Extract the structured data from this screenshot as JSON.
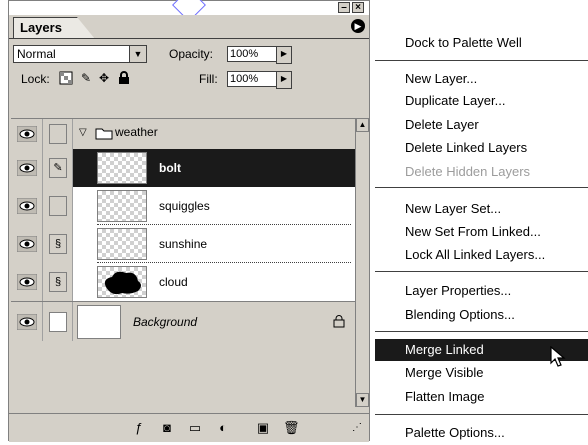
{
  "palette": {
    "tab_label": "Layers",
    "blend_mode": "Normal",
    "opacity_label": "Opacity:",
    "opacity_value": "100%",
    "lock_label": "Lock:",
    "fill_label": "Fill:",
    "fill_value": "100%",
    "layers": [
      {
        "name": "weather",
        "type": "group",
        "visible": true,
        "selected": false
      },
      {
        "name": "bolt",
        "type": "layer",
        "visible": true,
        "selected": true,
        "linked": false,
        "brush": true
      },
      {
        "name": "squiggles",
        "type": "layer",
        "visible": true,
        "selected": false,
        "linked": false
      },
      {
        "name": "sunshine",
        "type": "layer",
        "visible": true,
        "selected": false,
        "linked": true
      },
      {
        "name": "cloud",
        "type": "layer",
        "visible": true,
        "selected": false,
        "linked": true
      },
      {
        "name": "Background",
        "type": "background",
        "visible": true,
        "selected": false,
        "locked": true
      }
    ]
  },
  "menu": {
    "items": [
      {
        "label": "Dock to Palette Well",
        "enabled": true,
        "group": 0
      },
      {
        "label": "New Layer...",
        "enabled": true,
        "group": 1
      },
      {
        "label": "Duplicate Layer...",
        "enabled": true,
        "group": 1
      },
      {
        "label": "Delete Layer",
        "enabled": true,
        "group": 1
      },
      {
        "label": "Delete Linked Layers",
        "enabled": true,
        "group": 1
      },
      {
        "label": "Delete Hidden Layers",
        "enabled": false,
        "group": 1
      },
      {
        "label": "New Layer Set...",
        "enabled": true,
        "group": 2
      },
      {
        "label": "New Set From Linked...",
        "enabled": true,
        "group": 2
      },
      {
        "label": "Lock All Linked Layers...",
        "enabled": true,
        "group": 2
      },
      {
        "label": "Layer Properties...",
        "enabled": true,
        "group": 3
      },
      {
        "label": "Blending Options...",
        "enabled": true,
        "group": 3
      },
      {
        "label": "Merge Linked",
        "enabled": true,
        "group": 4,
        "highlighted": true
      },
      {
        "label": "Merge Visible",
        "enabled": true,
        "group": 4
      },
      {
        "label": "Flatten Image",
        "enabled": true,
        "group": 4
      },
      {
        "label": "Palette Options...",
        "enabled": true,
        "group": 5
      }
    ]
  },
  "colors": {
    "panel": "#d4d0c8",
    "selection": "#1a1a1a",
    "disabled_text": "#9c9c9c"
  }
}
